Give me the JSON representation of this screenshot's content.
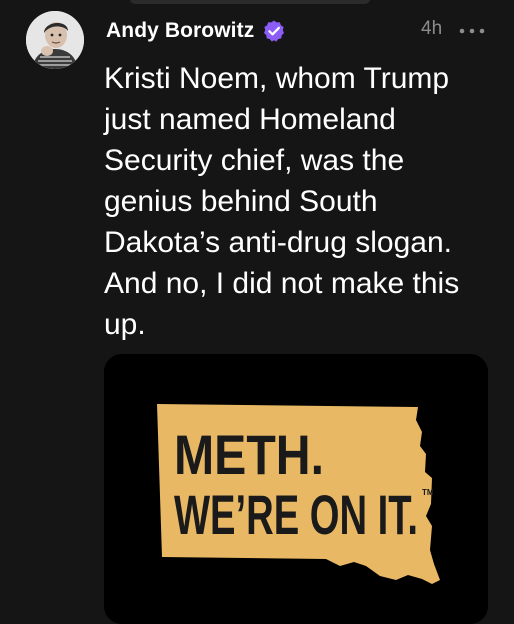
{
  "post": {
    "author": "Andy Borowitz",
    "verified_icon": "verified-badge-icon",
    "timestamp": "4h",
    "more_icon": "more-options-icon",
    "text": "Kristi Noem, whom Trump just named Homeland Security chief, was the genius behind South Dakota’s anti-drug slogan. And no, I did not make this up."
  },
  "media": {
    "line1": "METH.",
    "line2": "WE’RE ON IT.",
    "tm": "TM"
  },
  "colors": {
    "background": "#151515",
    "verified": "#8b5cf6",
    "state_fill": "#e8b865",
    "muted_text": "#8c8c8c"
  }
}
